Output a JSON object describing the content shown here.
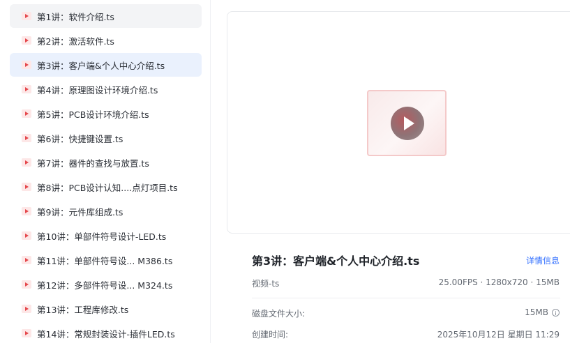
{
  "playlist": {
    "items": [
      {
        "label": "第1讲：软件介绍.ts",
        "state": "hover"
      },
      {
        "label": "第2讲：激活软件.ts",
        "state": ""
      },
      {
        "label": "第3讲：客户端&个人中心介绍.ts",
        "state": "active"
      },
      {
        "label": "第4讲：原理图设计环境介绍.ts",
        "state": ""
      },
      {
        "label": "第5讲：PCB设计环境介绍.ts",
        "state": ""
      },
      {
        "label": "第6讲：快捷键设置.ts",
        "state": ""
      },
      {
        "label": "第7讲：器件的查找与放置.ts",
        "state": ""
      },
      {
        "label": "第8讲：PCB设计认知....点灯项目.ts",
        "state": ""
      },
      {
        "label": "第9讲：元件库组成.ts",
        "state": ""
      },
      {
        "label": "第10讲：单部件符号设计-LED.ts",
        "state": ""
      },
      {
        "label": "第11讲：单部件符号设...  M386.ts",
        "state": ""
      },
      {
        "label": "第12讲：多部件符号设...  M324.ts",
        "state": ""
      },
      {
        "label": "第13讲：工程库修改.ts",
        "state": ""
      },
      {
        "label": "第14讲：常规封装设计-插件LED.ts",
        "state": ""
      }
    ]
  },
  "detail": {
    "title": "第3讲：客户端&个人中心介绍.ts",
    "details_link": "详情信息",
    "file_type": "视频-ts",
    "spec": "25.00FPS · 1280x720 · 15MB",
    "disk_size_label": "磁盘文件大小:",
    "disk_size_value": "15MB",
    "created_label": "创建时间:",
    "created_value": "2025年10月12日 星期日 11:29"
  }
}
